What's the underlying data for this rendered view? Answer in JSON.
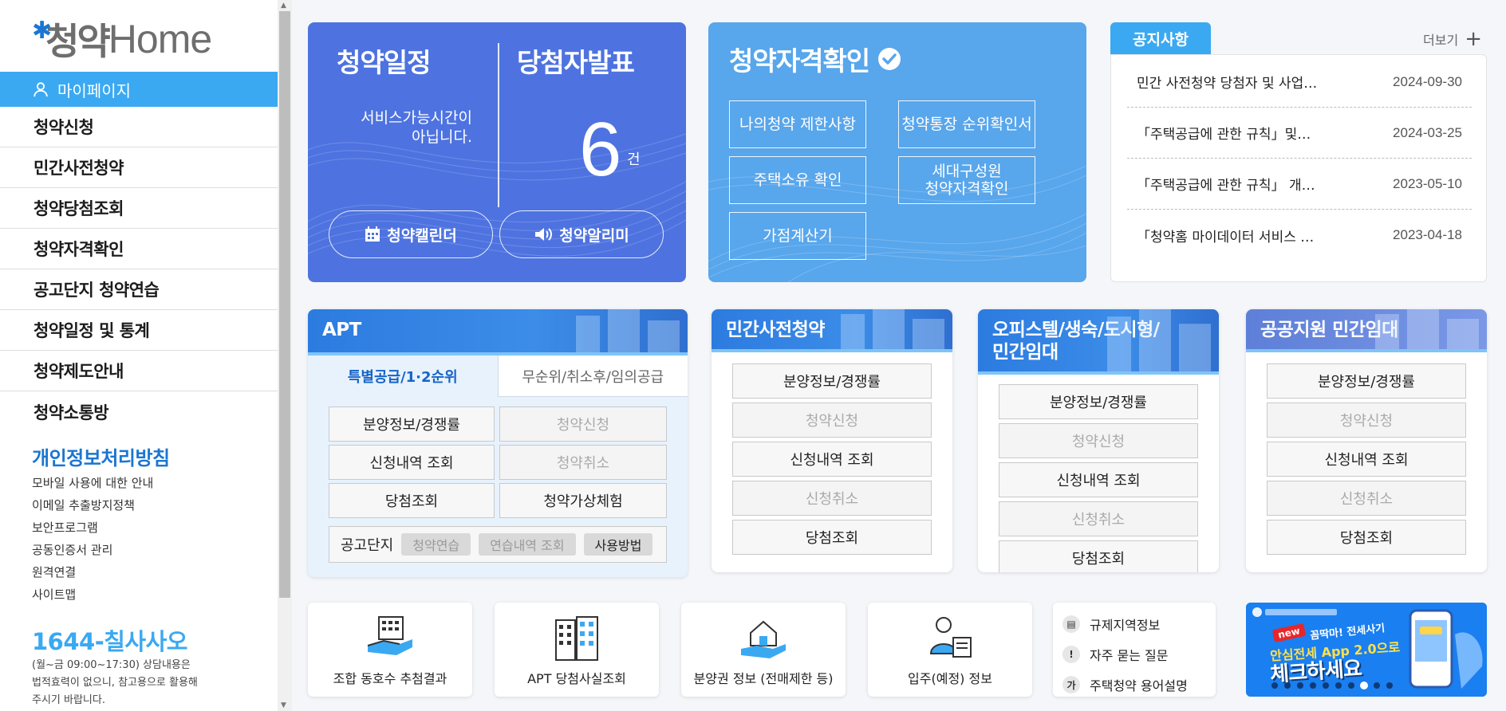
{
  "logo": {
    "ko": "청약",
    "en": "Home"
  },
  "sidebar": {
    "mypage": "마이페이지",
    "nav": [
      "청약신청",
      "민간사전청약",
      "청약당첨조회",
      "청약자격확인",
      "공고단지 청약연습",
      "청약일정 및 통계",
      "청약제도안내",
      "청약소통방"
    ],
    "privacy_title": "개인정보처리방침",
    "links": [
      "모바일 사용에 대한 안내",
      "이메일 추출방지정책",
      "보안프로그램",
      "공동인증서 관리",
      "원격연결",
      "사이트맵"
    ],
    "phone_prefix": "1644-",
    "phone_suffix": "칠사사오",
    "phone_desc_1": "(월~금 09:00~17:30) 상담내용은",
    "phone_desc_2": "법적효력이 없으니, 참고용으로 활용해",
    "phone_desc_3": "주시기 바랍니다."
  },
  "schedule_card": {
    "title_left": "청약일정",
    "title_right": "당첨자발표",
    "msg_1": "서비스가능시간이",
    "msg_2": "아닙니다.",
    "count": "6",
    "unit": "건",
    "btn_calendar": "청약캘린더",
    "btn_alarm": "청약알리미"
  },
  "qualify_card": {
    "title": "청약자격확인",
    "buttons": [
      "나의청약 제한사항",
      "청약통장 순위확인서",
      "주택소유 확인",
      "세대구성원",
      "청약자격확인",
      "가점계산기"
    ]
  },
  "notice": {
    "tab": "공지사항",
    "more": "더보기",
    "items": [
      {
        "title": "민간 사전청약 당첨자 및 사업…",
        "date": "2024-09-30"
      },
      {
        "title": "「주택공급에 관한 규칙」및…",
        "date": "2024-03-25"
      },
      {
        "title": "「주택공급에 관한 규칙」 개…",
        "date": "2023-05-10"
      },
      {
        "title": "「청약홈 마이데이터 서비스 …",
        "date": "2023-04-18"
      }
    ]
  },
  "apt": {
    "title": "APT",
    "tab_active": "특별공급/1·2순위",
    "tab_inactive": "무순위/취소후/임의공급",
    "buttons": [
      "분양정보/경쟁률",
      "청약신청",
      "신청내역 조회",
      "청약취소",
      "당첨조회",
      "청약가상체험"
    ],
    "foot_label": "공고단지",
    "chips": [
      "청약연습",
      "연습내역 조회",
      "사용방법"
    ]
  },
  "private": {
    "title": "민간사전청약",
    "buttons": [
      "분양정보/경쟁률",
      "청약신청",
      "신청내역 조회",
      "신청취소",
      "당첨조회"
    ]
  },
  "officetel": {
    "title_1": "오피스텔/생숙/도시형/",
    "title_2": "민간임대",
    "buttons": [
      "분양정보/경쟁률",
      "청약신청",
      "신청내역 조회",
      "신청취소",
      "당첨조회"
    ]
  },
  "public_rental": {
    "title": "공공지원 민간임대",
    "buttons": [
      "분양정보/경쟁률",
      "청약신청",
      "신청내역 조회",
      "신청취소",
      "당첨조회"
    ]
  },
  "bottom": {
    "cards": [
      "조합 동호수 추첨결과",
      "APT 당첨사실조회",
      "분양권 정보 (전매제한 등)",
      "입주(예정) 정보"
    ],
    "quick": [
      "규제지역정보",
      "자주 묻는 질문",
      "주택청약 용어설명"
    ]
  },
  "banner": {
    "new": "new",
    "line1": "꼼딱마! 전세사기",
    "line2": "안심전세 App 2.0으로",
    "line3": "체크하세요"
  },
  "colors": {
    "primary": "#3aa9f2",
    "royal": "#4e73e0",
    "sky": "#58a6ec",
    "link": "#1a76d2"
  }
}
